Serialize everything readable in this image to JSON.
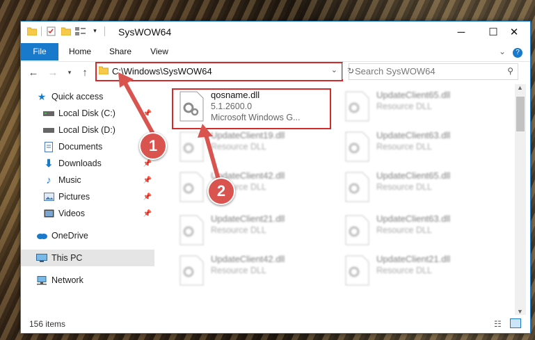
{
  "window": {
    "title": "SysWOW64",
    "accent": "#1979ca",
    "controls": {
      "minimize": "─",
      "maximize": "☐",
      "close": "✕"
    }
  },
  "ribbon": {
    "tabs": [
      {
        "label": "File"
      },
      {
        "label": "Home"
      },
      {
        "label": "Share"
      },
      {
        "label": "View"
      }
    ]
  },
  "address": {
    "path": "C:\\Windows\\SysWOW64",
    "search_placeholder": "Search SysWOW64"
  },
  "nav": {
    "items": [
      {
        "label": "Quick access",
        "icon": "star-icon"
      },
      {
        "label": "Local Disk (C:)",
        "icon": "drive-icon",
        "pinned": true
      },
      {
        "label": "Local Disk (D:)",
        "icon": "drive-icon"
      },
      {
        "label": "Documents",
        "icon": "documents-icon"
      },
      {
        "label": "Downloads",
        "icon": "download-icon",
        "pinned": true
      },
      {
        "label": "Music",
        "icon": "music-icon",
        "pinned": true
      },
      {
        "label": "Pictures",
        "icon": "pictures-icon",
        "pinned": true
      },
      {
        "label": "Videos",
        "icon": "videos-icon",
        "pinned": true
      },
      {
        "label": "OneDrive",
        "icon": "cloud-icon"
      },
      {
        "label": "This PC",
        "icon": "pc-icon",
        "selected": true
      },
      {
        "label": "Network",
        "icon": "network-icon"
      }
    ]
  },
  "files": {
    "highlighted": {
      "name": "qosname.dll",
      "version": "5.1.2600.0",
      "company": "Microsoft Windows G..."
    },
    "blurred": [
      {
        "name": "UpdateClient65.dll",
        "type": "Resource DLL"
      },
      {
        "name": "UpdateClient19.dll",
        "type": "Resource DLL"
      },
      {
        "name": "UpdateClient63.dll",
        "type": "Resource DLL"
      },
      {
        "name": "UpdateClient42.dll",
        "type": "Resource DLL"
      },
      {
        "name": "UpdateClient65.dll",
        "type": "Resource DLL"
      },
      {
        "name": "UpdateClient21.dll",
        "type": "Resource DLL"
      },
      {
        "name": "UpdateClient63.dll",
        "type": "Resource DLL"
      },
      {
        "name": "UpdateClient42.dll",
        "type": "Resource DLL"
      },
      {
        "name": "UpdateClient21.dll",
        "type": "Resource DLL"
      }
    ]
  },
  "status": {
    "item_count": "156 items"
  },
  "annotations": {
    "badge1": "1",
    "badge2": "2",
    "color": "#d9534f"
  }
}
